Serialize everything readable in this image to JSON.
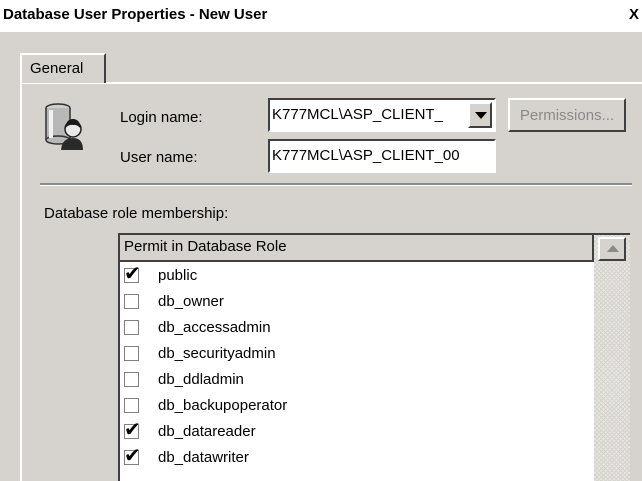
{
  "window": {
    "title": "Database User Properties - New User",
    "close_glyph": "X"
  },
  "tabs": [
    {
      "label": "General",
      "selected": true
    }
  ],
  "icons": {
    "user": "database-user-icon",
    "dropdown": "chevron-down-icon",
    "scroll_up": "scroll-up-arrow-icon",
    "check": "checkmark-icon"
  },
  "form": {
    "login_name_label": "Login name:",
    "login_name_value": "K777MCL\\ASP_CLIENT_",
    "user_name_label": "User name:",
    "user_name_value": "K777MCL\\ASP_CLIENT_00",
    "permissions_button": "Permissions...",
    "permissions_enabled": false
  },
  "roles": {
    "section_label": "Database role membership:",
    "column_header": "Permit in Database Role",
    "items": [
      {
        "name": "public",
        "checked": true
      },
      {
        "name": "db_owner",
        "checked": false
      },
      {
        "name": "db_accessadmin",
        "checked": false
      },
      {
        "name": "db_securityadmin",
        "checked": false
      },
      {
        "name": "db_ddladmin",
        "checked": false
      },
      {
        "name": "db_backupoperator",
        "checked": false
      },
      {
        "name": "db_datareader",
        "checked": true
      },
      {
        "name": "db_datawriter",
        "checked": true
      }
    ]
  }
}
